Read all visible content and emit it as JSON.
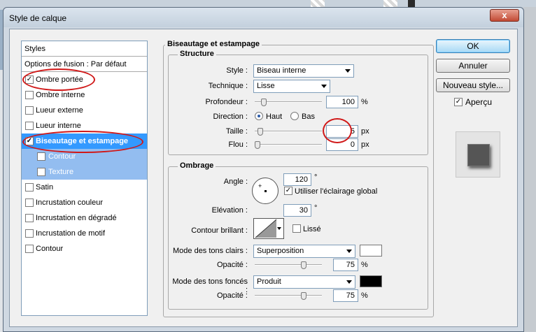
{
  "window": {
    "title": "Style de calque",
    "close_label": "x"
  },
  "styles_panel": {
    "header": "Styles",
    "fusion": "Options de fusion : Par défaut",
    "items": [
      {
        "label": "Ombre portée",
        "checked": true
      },
      {
        "label": "Ombre interne",
        "checked": false
      },
      {
        "label": "Lueur externe",
        "checked": false
      },
      {
        "label": "Lueur interne",
        "checked": false
      },
      {
        "label": "Biseautage et estampage",
        "checked": true,
        "selected": true
      },
      {
        "label": "Contour",
        "checked": false,
        "sub": true
      },
      {
        "label": "Texture",
        "checked": false,
        "sub": true
      },
      {
        "label": "Satin",
        "checked": false
      },
      {
        "label": "Incrustation couleur",
        "checked": false
      },
      {
        "label": "Incrustation en dégradé",
        "checked": false
      },
      {
        "label": "Incrustation de motif",
        "checked": false
      },
      {
        "label": "Contour",
        "checked": false
      }
    ]
  },
  "bevel": {
    "group_title": "Biseautage et estampage",
    "structure": {
      "title": "Structure",
      "style_label": "Style :",
      "style_value": "Biseau interne",
      "technique_label": "Technique :",
      "technique_value": "Lisse",
      "depth_label": "Profondeur :",
      "depth_value": "100",
      "depth_level": 0.1,
      "percent": "%",
      "direction_label": "Direction :",
      "dir_up": "Haut",
      "dir_down": "Bas",
      "size_label": "Taille :",
      "size_value": "5",
      "size_level": 0.05,
      "soften_label": "Flou :",
      "soften_value": "0",
      "soften_level": 0.0,
      "px": "px"
    },
    "shading": {
      "title": "Ombrage",
      "angle_label": "Angle :",
      "angle_value": "120",
      "degree": "°",
      "global_light_label": "Utiliser l'éclairage global",
      "global_light_checked": true,
      "altitude_label": "Elévation :",
      "altitude_value": "30",
      "gloss_label": "Contour brillant :",
      "antialias_label": "Lissé",
      "highlight_mode_label": "Mode des tons clairs :",
      "highlight_mode_value": "Superposition",
      "highlight_color": "#ffffff",
      "opacity_label": "Opacité :",
      "highlight_opacity": "75",
      "highlight_opacity_level": 0.75,
      "shadow_mode_label": "Mode des tons foncés :",
      "shadow_mode_value": "Produit",
      "shadow_color": "#000000",
      "shadow_opacity": "75",
      "shadow_opacity_level": 0.75,
      "percent": "%"
    }
  },
  "buttons": {
    "ok": "OK",
    "cancel": "Annuler",
    "new_style": "Nouveau style...",
    "preview_label": "Aperçu",
    "preview_checked": true
  },
  "colors": {
    "selection": "#3399ff",
    "sub_selection": "#93bdf0",
    "annotation": "#d01818"
  }
}
